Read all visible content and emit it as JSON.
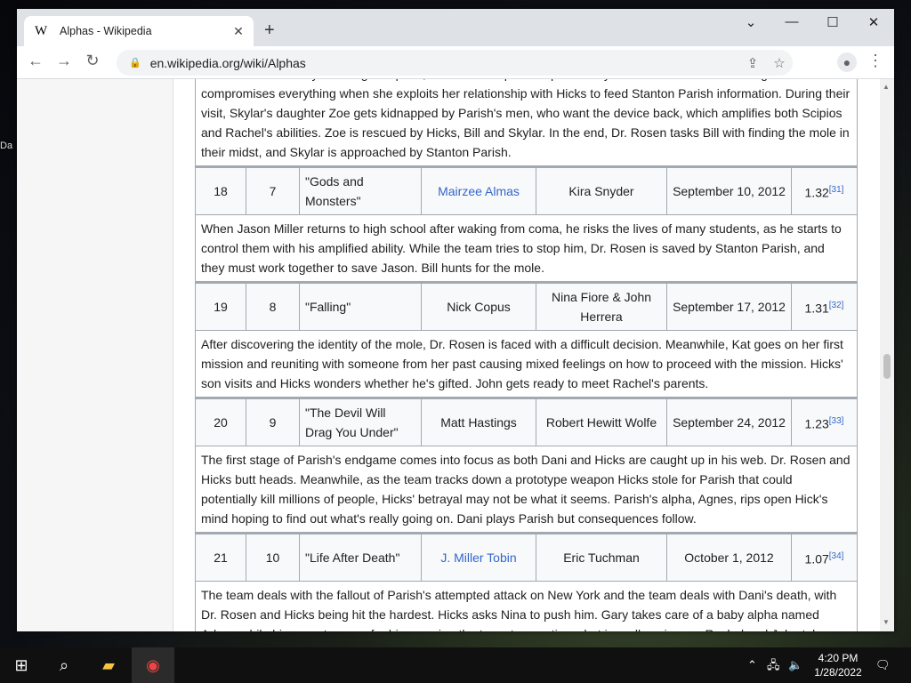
{
  "browser": {
    "tab_title": "Alphas - Wikipedia",
    "tab_logo": "W",
    "url": "en.wikipedia.org/wiki/Alphas"
  },
  "desktop": {
    "icon_label": "Da"
  },
  "top_summary": "to a small community for refugee Alphas, in order to request help from Skylar Adams. Dr. Rosen's daughter compromises everything when she exploits her relationship with Hicks to feed Stanton Parish information. During their visit, Skylar's daughter Zoe gets kidnapped by Parish's men, who want the device back, which amplifies both Scipios and Rachel's abilities. Zoe is rescued by Hicks, Bill and Skylar. In the end, Dr. Rosen tasks Bill with finding the mole in their midst, and Skylar is approached by Stanton Parish.",
  "episodes": [
    {
      "overall": "18",
      "season": "7",
      "title": "\"Gods and Monsters\"",
      "director": "Mairzee Almas",
      "writer": "Kira Snyder",
      "air_date": "September 10, 2012",
      "viewers": "1.32",
      "ref": "[31]",
      "summary": "When Jason Miller returns to high school after waking from coma, he risks the lives of many students, as he starts to control them with his amplified ability. While the team tries to stop him, Dr. Rosen is saved by Stanton Parish, and they must work together to save Jason. Bill hunts for the mole."
    },
    {
      "overall": "19",
      "season": "8",
      "title": "\"Falling\"",
      "director": "Nick Copus",
      "writer": "Nina Fiore & John Herrera",
      "air_date": "September 17, 2012",
      "viewers": "1.31",
      "ref": "[32]",
      "summary": "After discovering the identity of the mole, Dr. Rosen is faced with a difficult decision. Meanwhile, Kat goes on her first mission and reuniting with someone from her past causing mixed feelings on how to proceed with the mission. Hicks' son visits and Hicks wonders whether he's gifted. John gets ready to meet Rachel's parents."
    },
    {
      "overall": "20",
      "season": "9",
      "title": "\"The Devil Will Drag You Under\"",
      "director": "Matt Hastings",
      "writer": "Robert Hewitt Wolfe",
      "air_date": "September 24, 2012",
      "viewers": "1.23",
      "ref": "[33]",
      "summary": "The first stage of Parish's endgame comes into focus as both Dani and Hicks are caught up in his web. Dr. Rosen and Hicks butt heads. Meanwhile, as the team tracks down a prototype weapon Hicks stole for Parish that could potentially kill millions of people, Hicks' betrayal may not be what it seems. Parish's alpha, Agnes, rips open Hick's mind hoping to find out what's really going on. Dani plays Parish but consequences follow."
    },
    {
      "overall": "21",
      "season": "10",
      "title": "\"Life After Death\"",
      "director": "J. Miller Tobin",
      "writer": "Eric Tuchman",
      "air_date": "October 1, 2012",
      "viewers": "1.07",
      "ref": "[34]",
      "summary": "The team deals with the fallout of Parish's attempted attack on New York and the team deals with Dani's death, with Dr. Rosen and Hicks being hit the hardest. Hicks asks Nina to push him. Gary takes care of a baby alpha named Adam, while his parents come for him causing the team to question what is really going on. Rachel and John take a big step in their relationship."
    }
  ],
  "director_links": [
    "Mairzee Almas",
    "J. Miller Tobin"
  ],
  "taskbar": {
    "time": "4:20 PM",
    "date": "1/28/2022"
  }
}
